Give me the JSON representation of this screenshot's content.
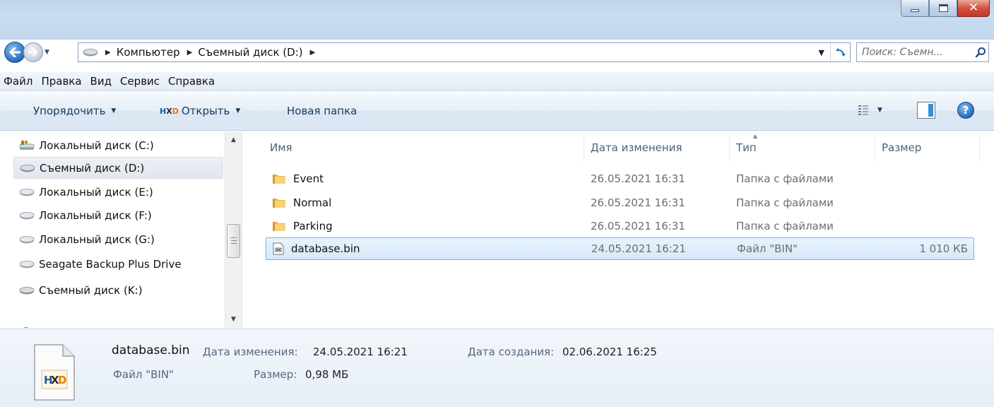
{
  "window": {
    "controls": {
      "minimize": "minimize",
      "maximize": "maximize",
      "close": "close"
    }
  },
  "address": {
    "crumbs": [
      "Компьютер",
      "Съемный диск (D:)"
    ],
    "search_placeholder": "Поиск: Съемн..."
  },
  "menubar": [
    "Файл",
    "Правка",
    "Вид",
    "Сервис",
    "Справка"
  ],
  "toolbar": {
    "organize": "Упорядочить",
    "open": "Открыть",
    "new_folder": "Новая папка"
  },
  "navpane": {
    "items": [
      {
        "label": "Локальный диск (C:)",
        "icon": "system-drive-icon"
      },
      {
        "label": "Съемный диск (D:)",
        "icon": "removable-drive-icon",
        "selected": true
      },
      {
        "label": "Локальный диск (E:)",
        "icon": "drive-icon"
      },
      {
        "label": "Локальный диск (F:)",
        "icon": "drive-icon"
      },
      {
        "label": "Локальный диск (G:)",
        "icon": "drive-icon"
      },
      {
        "label": "Seagate Backup Plus Drive",
        "icon": "drive-icon"
      },
      {
        "label": "Съемный диск (K:)",
        "icon": "removable-drive-icon"
      }
    ],
    "partial_item": "С"
  },
  "filelist": {
    "columns": [
      "Имя",
      "Дата изменения",
      "Тип",
      "Размер"
    ],
    "rows": [
      {
        "name": "Event",
        "date": "26.05.2021 16:31",
        "type": "Папка с файлами",
        "size": "",
        "icon": "folder-icon"
      },
      {
        "name": "Normal",
        "date": "26.05.2021 16:31",
        "type": "Папка с файлами",
        "size": "",
        "icon": "folder-icon"
      },
      {
        "name": "Parking",
        "date": "26.05.2021 16:31",
        "type": "Папка с файлами",
        "size": "",
        "icon": "folder-icon"
      },
      {
        "name": "database.bin",
        "date": "24.05.2021 16:21",
        "type": "Файл \"BIN\"",
        "size": "1 010 КБ",
        "icon": "file-icon",
        "selected": true
      }
    ]
  },
  "details": {
    "name": "database.bin",
    "modified_label": "Дата изменения:",
    "modified_value": "24.05.2021 16:21",
    "created_label": "Дата создания:",
    "created_value": "02.06.2021 16:25",
    "type": "Файл \"BIN\"",
    "size_label": "Размер:",
    "size_value": "0,98 МБ"
  },
  "colors": {
    "selection_border": "#84acdd",
    "title_bg": "#c2d6ed",
    "close_button": "#c9402e"
  }
}
